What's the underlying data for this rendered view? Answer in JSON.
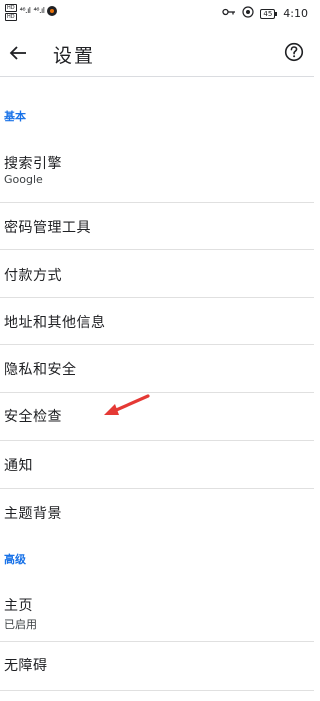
{
  "status_bar": {
    "hd_top": "HD",
    "hd_bottom": "HD",
    "signal_1": "⁴⁶.ıl",
    "signal_2": "⁴⁶.ıl",
    "battery": "45",
    "time": "4:10"
  },
  "app_bar": {
    "title": "设置",
    "back_icon": "arrow-left",
    "help_icon": "help-circle"
  },
  "sections": [
    {
      "header": "基本",
      "items": [
        {
          "title": "搜索引擎",
          "subtitle": "Google"
        },
        {
          "title": "密码管理工具"
        },
        {
          "title": "付款方式"
        },
        {
          "title": "地址和其他信息"
        },
        {
          "title": "隐私和安全"
        },
        {
          "title": "安全检查"
        },
        {
          "title": "通知"
        },
        {
          "title": "主题背景"
        }
      ]
    },
    {
      "header": "高级",
      "items": [
        {
          "title": "主页",
          "subtitle": "已启用"
        },
        {
          "title": "无障碍"
        }
      ]
    }
  ],
  "colors": {
    "accent": "#1a73e8",
    "annotation_arrow": "#e53935"
  }
}
